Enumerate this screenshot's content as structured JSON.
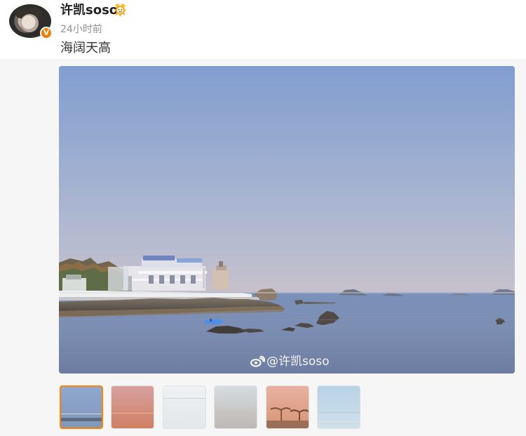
{
  "post": {
    "username": "许凯soso",
    "timestamp": "24小时前",
    "content": "海阔天高",
    "verified": true,
    "medal_icon": "medal-icon"
  },
  "media": {
    "watermark": "@许凯soso",
    "selected_index": 0,
    "thumbnails": [
      {
        "name": "coast-house-thumbnail",
        "colors": [
          "#8ea8cf",
          "#8397b8"
        ]
      },
      {
        "name": "sunset-sea-thumbnail",
        "colors": [
          "#d7a1a0",
          "#cf8063"
        ]
      },
      {
        "name": "white-sea-thumbnail",
        "colors": [
          "#eef0f2",
          "#e4e7ea"
        ]
      },
      {
        "name": "calm-horizon-thumbnail",
        "colors": [
          "#d6dce2",
          "#bdb8b4"
        ]
      },
      {
        "name": "palm-sunset-thumbnail",
        "colors": [
          "#e8b2a1",
          "#d69577"
        ]
      },
      {
        "name": "pastel-beach-thumbnail",
        "colors": [
          "#b8d2e6",
          "#cfe0ea"
        ]
      }
    ]
  },
  "colors": {
    "accent": "#ff8200",
    "text_primary": "#222222",
    "text_secondary": "#8f8f8f",
    "background_media": "#f6f6f6"
  }
}
